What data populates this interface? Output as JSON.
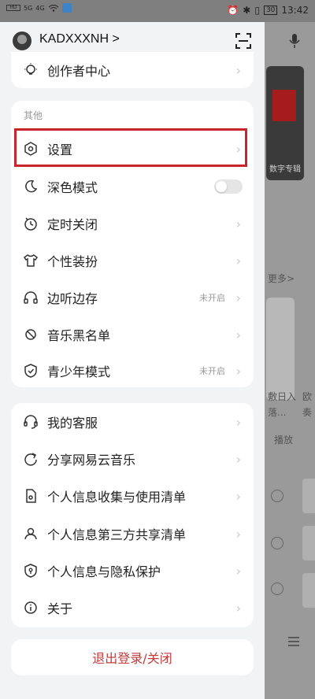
{
  "status_bar": {
    "left_items": [
      "HD",
      "HD",
      "5G",
      "4G"
    ],
    "battery": "30",
    "time": "13:42"
  },
  "header": {
    "username": "KADXXXNH",
    "chevron": ">"
  },
  "top_card": {
    "items": [
      {
        "label": "创作者中心",
        "icon": "lightbulb-icon"
      }
    ]
  },
  "other_card": {
    "section_label": "其他",
    "items": [
      {
        "label": "设置",
        "icon": "settings-icon"
      },
      {
        "label": "深色模式",
        "icon": "moon-icon",
        "toggle_on": false
      },
      {
        "label": "定时关闭",
        "icon": "timer-icon"
      },
      {
        "label": "个性装扮",
        "icon": "tshirt-icon"
      },
      {
        "label": "边听边存",
        "icon": "headphones-icon",
        "status": "未开启"
      },
      {
        "label": "音乐黑名单",
        "icon": "block-icon"
      },
      {
        "label": "青少年模式",
        "icon": "shield-check-icon",
        "status": "未开启"
      }
    ]
  },
  "service_card": {
    "items": [
      {
        "label": "我的客服",
        "icon": "headset-icon"
      },
      {
        "label": "分享网易云音乐",
        "icon": "share-icon"
      },
      {
        "label": "个人信息收集与使用清单",
        "icon": "doc-info-icon"
      },
      {
        "label": "个人信息第三方共享清单",
        "icon": "people-share-icon"
      },
      {
        "label": "个人信息与隐私保护",
        "icon": "privacy-shield-icon"
      },
      {
        "label": "关于",
        "icon": "info-icon"
      }
    ]
  },
  "logout": {
    "label": "退出登录/关闭"
  },
  "background": {
    "card_tag": "数字专辑",
    "more": "更多>",
    "texts": [
      "敷日入",
      "落...",
      "欧",
      "奏"
    ],
    "play": "播放"
  },
  "colors": {
    "accent_red": "#c9252c",
    "logout_text": "#c23a3a"
  }
}
